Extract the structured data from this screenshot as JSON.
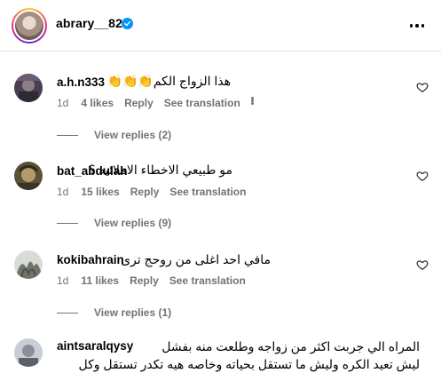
{
  "header": {
    "username": "abrary__82",
    "verified_color": "#0095f6"
  },
  "comments": [
    {
      "username": "a.h.n333",
      "text": "هذا الزواج الكم👏👏👏",
      "time": "1d",
      "likes": "4 likes",
      "reply": "Reply",
      "translation": "See translation",
      "has_more": true,
      "view_replies": "View replies (2)"
    },
    {
      "username": "bat_abdulah",
      "text": "مو طبيعي الاخطاء الاملائيه ؟",
      "time": "1d",
      "likes": "15 likes",
      "reply": "Reply",
      "translation": "See translation",
      "view_replies": "View replies (9)"
    },
    {
      "username": "kokibahrain",
      "text": "مافي احد اغلى من روحج ترى",
      "time": "1d",
      "likes": "11 likes",
      "reply": "Reply",
      "translation": "See translation",
      "view_replies": "View replies (1)"
    },
    {
      "username": "aintsaralqysy",
      "text_line1": "المراه الي جربت اكثر من زواجه وطلعت منه بفشل",
      "text_line2": "ليش تعيد الكره وليش ما تستقل بحياته وخاصه هيه تكدر تستقل وكل"
    }
  ]
}
